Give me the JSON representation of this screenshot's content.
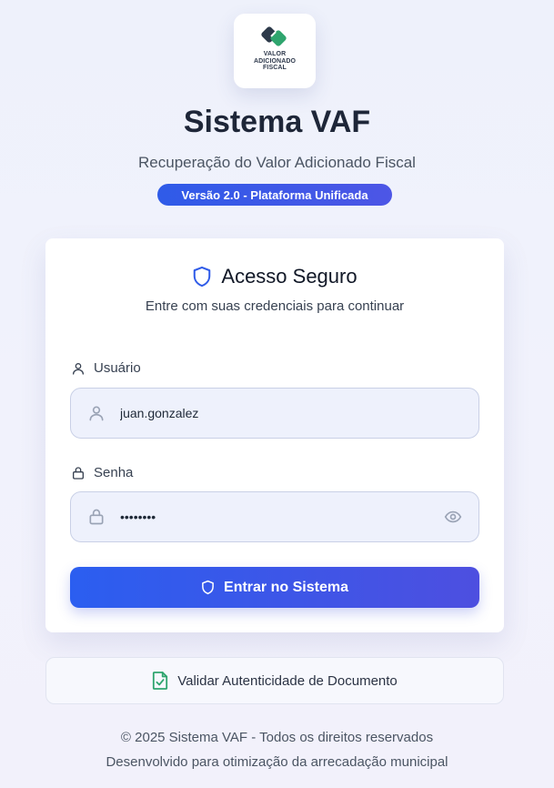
{
  "logo": {
    "lines": [
      "VALOR",
      "ADICIONADO",
      "FISCAL"
    ],
    "icon": "vaf-logo-mark"
  },
  "header": {
    "title": "Sistema VAF",
    "subtitle": "Recuperação do Valor Adicionado Fiscal",
    "version_badge": "Versão 2.0 - Plataforma Unificada"
  },
  "login": {
    "title": "Acesso Seguro",
    "title_icon": "shield-icon",
    "subtitle": "Entre com suas credenciais para continuar",
    "username": {
      "label": "Usuário",
      "value": "juan.gonzalez",
      "icon": "user-icon"
    },
    "password": {
      "label": "Senha",
      "value": "password",
      "icon": "lock-icon",
      "toggle_icon": "eye-icon"
    },
    "submit_label": "Entrar no Sistema"
  },
  "validate": {
    "label": "Validar Autenticidade de Documento",
    "icon": "document-check-icon"
  },
  "footer": {
    "copyright": "© 2025 Sistema VAF - Todos os direitos reservados",
    "tagline": "Desenvolvido para otimização da arrecadação municipal"
  },
  "colors": {
    "accent": "#2f5be8",
    "accent_end": "#4d4fe0",
    "logo_green": "#2fa56e",
    "logo_dark": "#2d3a4a"
  }
}
